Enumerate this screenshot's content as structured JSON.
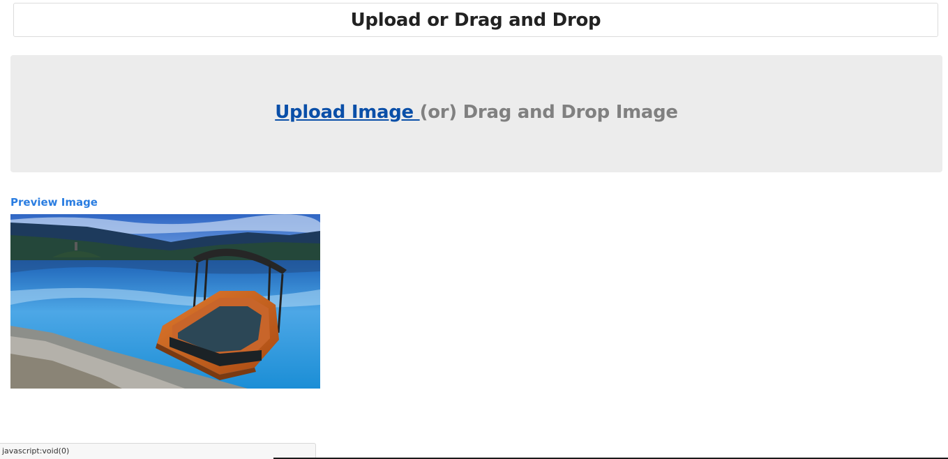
{
  "header": {
    "title": "Upload or Drag and Drop"
  },
  "dropzone": {
    "upload_link": "Upload Image ",
    "rest_text": "(or) Drag and Drop Image"
  },
  "preview": {
    "label": "Preview Image"
  },
  "status_bar": {
    "text": "javascript:void(0)"
  },
  "colors": {
    "link": "#0a4fa8",
    "preview_label": "#2a7de1",
    "dropzone_bg": "#ececec",
    "muted_text": "#808080"
  }
}
